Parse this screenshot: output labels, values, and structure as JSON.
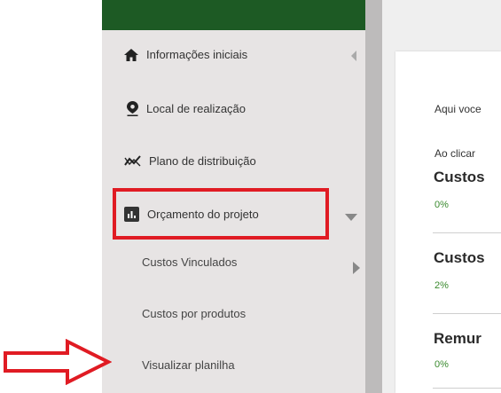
{
  "sidebar": {
    "items": [
      {
        "label": "Informações iniciais",
        "icon": "home-icon"
      },
      {
        "label": "Local de realização",
        "icon": "location-pin-icon"
      },
      {
        "label": "Plano de distribuição",
        "icon": "trending-icon"
      },
      {
        "label": "Orçamento do projeto",
        "icon": "chart-icon"
      }
    ],
    "subitems": [
      {
        "label": "Custos Vinculados"
      },
      {
        "label": "Custos por produtos"
      },
      {
        "label": "Visualizar planilha"
      }
    ]
  },
  "main": {
    "intro_lines": [
      "Aqui voce",
      "Ao clicar"
    ],
    "sections": [
      {
        "title": "Custos",
        "pct": "0%"
      },
      {
        "title": "Custos",
        "pct": "2%"
      },
      {
        "title": "Remur",
        "pct": "0%"
      }
    ]
  },
  "colors": {
    "brand_green": "#1d5a24",
    "highlight_red": "#e01b23",
    "percent_green": "#3a8a2e"
  }
}
